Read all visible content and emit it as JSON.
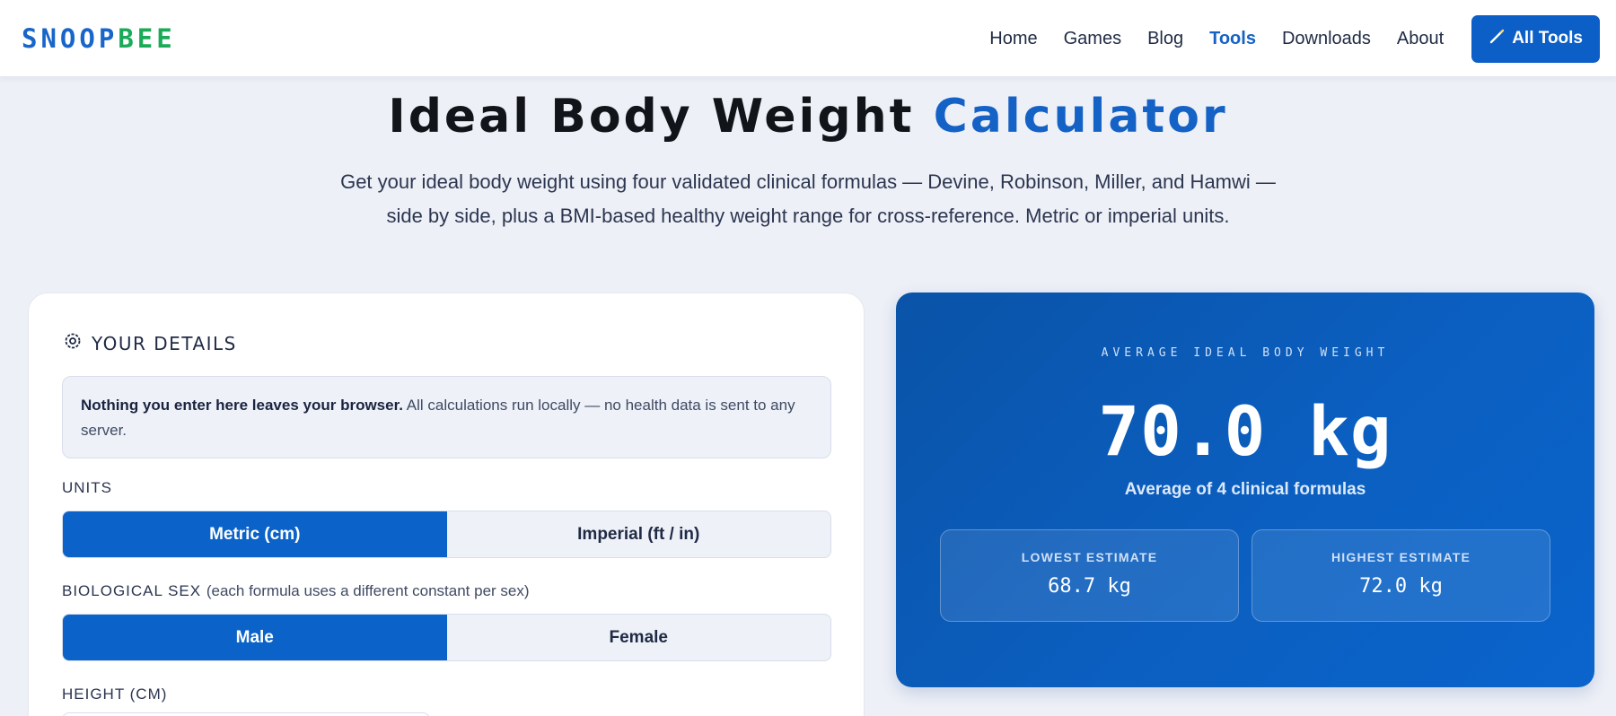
{
  "brand": {
    "part1": "SNOOP",
    "part2": "BEE"
  },
  "nav": {
    "items": [
      "Home",
      "Games",
      "Blog",
      "Tools",
      "Downloads",
      "About"
    ],
    "active": "Tools",
    "cta_label": "All Tools",
    "cta_icon": "wand-icon"
  },
  "page": {
    "title_main": "Ideal Body Weight",
    "title_accent": "Calculator",
    "subtitle_line1": "Get your ideal body weight using four validated clinical formulas — Devine, Robinson, Miller, and Hamwi —",
    "subtitle_line2": "side by side, plus a BMI-based healthy weight range for cross-reference. Metric or imperial units."
  },
  "details": {
    "heading": "YOUR DETAILS",
    "heading_icon": "gear-icon",
    "privacy_bold": "Nothing you enter here leaves your browser.",
    "privacy_rest": "All calculations run locally — no health data is sent to any server.",
    "units_label": "UNITS",
    "units_options": [
      "Metric (cm)",
      "Imperial (ft / in)"
    ],
    "units_selected": "Metric (cm)",
    "sex_label": "BIOLOGICAL SEX",
    "sex_hint": "(each formula uses a different constant per sex)",
    "sex_options": [
      "Male",
      "Female"
    ],
    "sex_selected": "Male",
    "height_label": "HEIGHT (CM)"
  },
  "result": {
    "label": "AVERAGE IDEAL BODY WEIGHT",
    "value": "70.0 kg",
    "sub": "Average of 4 clinical formulas",
    "lowest_label": "LOWEST ESTIMATE",
    "lowest_value": "68.7 kg",
    "highest_label": "HIGHEST ESTIMATE",
    "highest_value": "72.0 kg"
  },
  "colors": {
    "accent": "#1562c6",
    "brand_green": "#1aaa58",
    "result_bg": "#0b5fc0",
    "page_bg": "#eef0f7"
  }
}
